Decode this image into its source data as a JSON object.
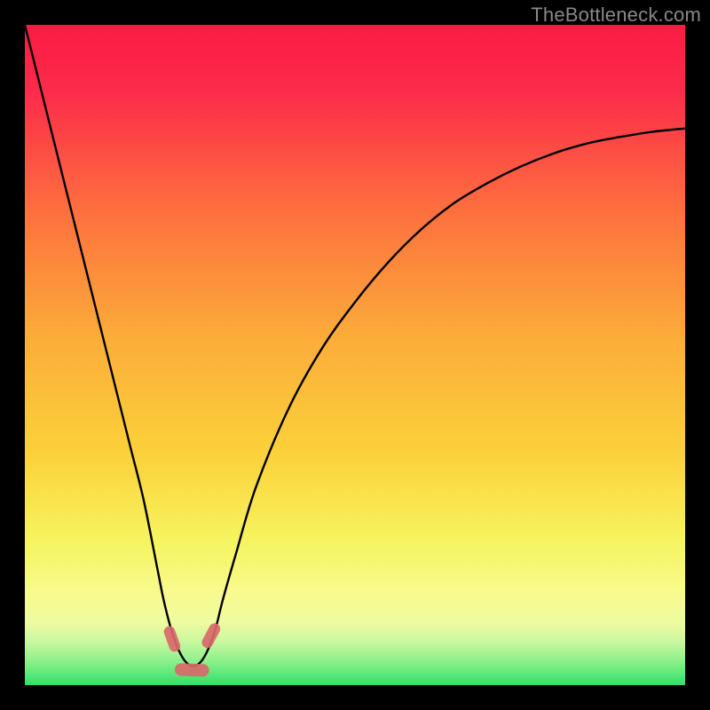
{
  "watermark": "TheBottleneck.com",
  "chart_data": {
    "type": "line",
    "title": "",
    "xlabel": "",
    "ylabel": "",
    "xlim": [
      0,
      100
    ],
    "ylim": [
      0,
      100
    ],
    "background_gradient": {
      "top": "#fb1b44",
      "mid": "#fcd13a",
      "near_bottom": "#f8fa8e",
      "bottom": "#2fe069"
    },
    "series": [
      {
        "name": "bottleneck-curve",
        "color": "#000000",
        "x": [
          0,
          2,
          4,
          6,
          8,
          10,
          12,
          14,
          16,
          18,
          20,
          21,
          22,
          23,
          24,
          25,
          26,
          27,
          28,
          29,
          30,
          32,
          35,
          40,
          45,
          50,
          55,
          60,
          65,
          70,
          75,
          80,
          85,
          90,
          95,
          100
        ],
        "y": [
          100,
          92,
          84,
          76,
          68,
          60,
          52,
          44,
          36,
          28,
          18,
          13,
          9,
          6,
          4,
          3,
          3,
          4,
          6,
          9,
          13,
          20,
          30,
          42,
          51,
          58,
          64,
          69,
          73,
          76,
          78.5,
          80.5,
          82,
          83,
          83.8,
          84.3
        ]
      }
    ],
    "markers": [
      {
        "name": "left-side-red-marker",
        "shape": "capsule",
        "color": "#d9686a",
        "cx": 22.3,
        "cy": 7.0,
        "rot": 70,
        "len": 4.0,
        "thick": 1.7
      },
      {
        "name": "right-side-red-marker",
        "shape": "capsule",
        "color": "#d9686a",
        "cx": 28.2,
        "cy": 7.5,
        "rot": -62,
        "len": 4.0,
        "thick": 1.7
      },
      {
        "name": "bottom-red-marker",
        "shape": "capsule",
        "color": "#d9686a",
        "cx": 25.3,
        "cy": 2.3,
        "rot": 2,
        "len": 5.2,
        "thick": 1.9
      }
    ]
  }
}
